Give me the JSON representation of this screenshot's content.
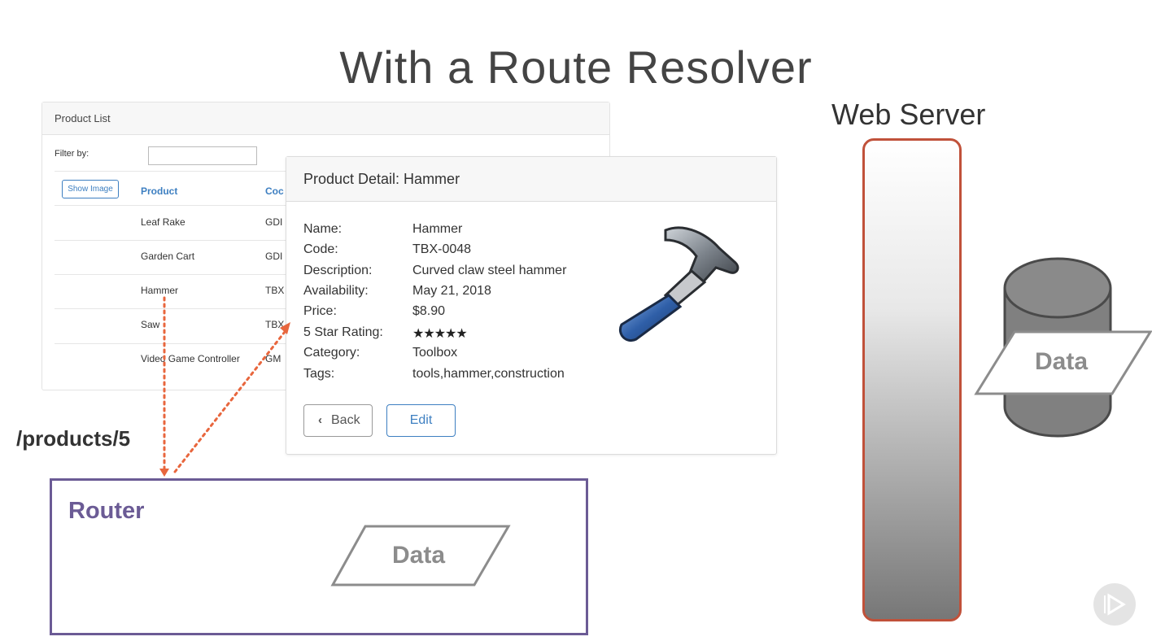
{
  "title": "With a Route Resolver",
  "product_list": {
    "header": "Product List",
    "filter_label": "Filter by:",
    "filter_value": "",
    "show_image_label": "Show Image",
    "columns": [
      "Product",
      "Coc"
    ],
    "rows": [
      {
        "product": "Leaf Rake",
        "code": "GDI"
      },
      {
        "product": "Garden Cart",
        "code": "GDI"
      },
      {
        "product": "Hammer",
        "code": "TBX"
      },
      {
        "product": "Saw",
        "code": "TBX"
      },
      {
        "product": "Video Game Controller",
        "code": "GM"
      }
    ]
  },
  "product_detail": {
    "header": "Product Detail: Hammer",
    "fields": [
      {
        "label": "Name:",
        "value": "Hammer"
      },
      {
        "label": "Code:",
        "value": "TBX-0048"
      },
      {
        "label": "Description:",
        "value": "Curved claw steel hammer"
      },
      {
        "label": "Availability:",
        "value": "May 21, 2018"
      },
      {
        "label": "Price:",
        "value": "$8.90"
      },
      {
        "label": "5 Star Rating:",
        "value": ""
      },
      {
        "label": "Category:",
        "value": "Toolbox"
      },
      {
        "label": "Tags:",
        "value": "tools,hammer,construction"
      }
    ],
    "rating_stars": 5,
    "back_label": "Back",
    "edit_label": "Edit"
  },
  "route": "/products/5",
  "router_label": "Router",
  "router_data_label": "Data",
  "web_server_label": "Web Server",
  "db_data_label": "Data",
  "colors": {
    "accent_blue": "#3d7fc1",
    "router_purple": "#6b5b95",
    "server_border": "#c0513a",
    "arrow_orange": "#e8663d"
  }
}
